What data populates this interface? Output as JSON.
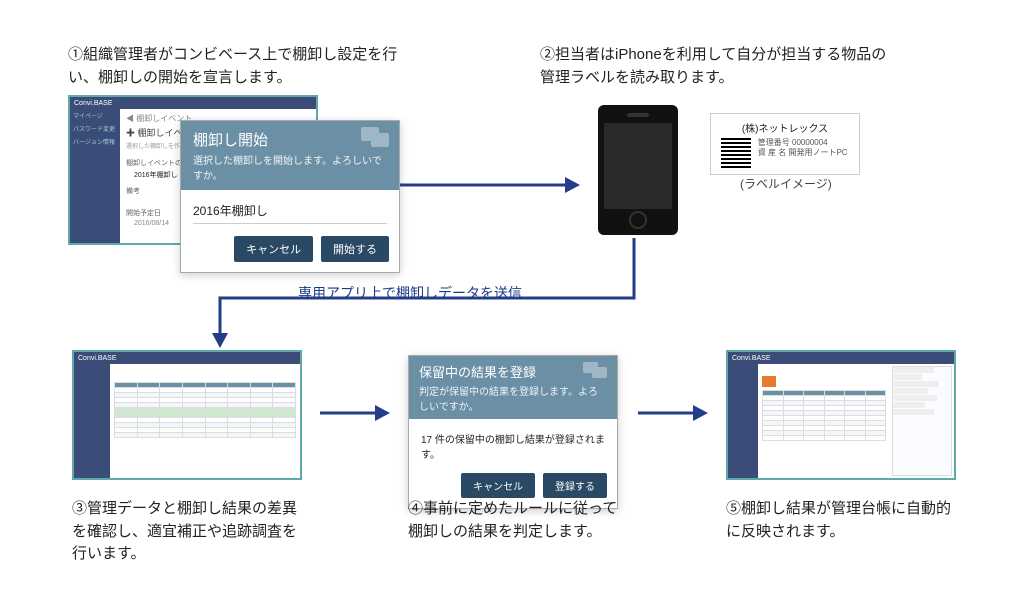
{
  "steps": {
    "s1": "①組織管理者がコンビベース上で棚卸し設定を行い、棚卸しの開始を宣言します。",
    "s2": "②担当者はiPhoneを利用して自分が担当する物品の管理ラベルを読み取ります。",
    "s3": "③管理データと棚卸し結果の差異を確認し、適宜補正や追跡調査を行います。",
    "s4": "④事前に定めたルールに従って棚卸しの結果を判定します。",
    "s5": "⑤棚卸し結果が管理台帳に自動的に反映されます。"
  },
  "flow_note": "専用アプリ上で棚卸しデータを送信",
  "dialog1": {
    "title": "棚卸し開始",
    "sub": "選択した棚卸しを開始します。よろしいですか。",
    "field": "2016年棚卸し",
    "cancel": "キャンセル",
    "ok": "開始する"
  },
  "dialog2": {
    "title": "保留中の結果を登録",
    "sub": "判定が保留中の結果を登録します。よろしいですか。",
    "msg": "17 件の保留中の棚卸し結果が登録されます。",
    "cancel": "キャンセル",
    "ok": "登録する"
  },
  "form": {
    "heading": "棚卸しイベントの新規",
    "hint": "選択した棚卸しを作成します。必要項目を入力してください。",
    "l_name": "棚卸しイベントの名称",
    "v_name": "2016年棚卸し",
    "l_remark": "備考",
    "l_date": "開始予定日",
    "v_date": "2016/08/14"
  },
  "app": {
    "brand": "Convi.BASE",
    "menu1": "マイページ",
    "menu2": "パスワード変更",
    "menu3": "バージョン情報"
  },
  "label": {
    "company": "(株)ネットレックス",
    "l1": "管理番号",
    "v1": "00000004",
    "l2": "資 産 名",
    "v2": "開発用ノートPC",
    "caption": "(ラベルイメージ)"
  }
}
